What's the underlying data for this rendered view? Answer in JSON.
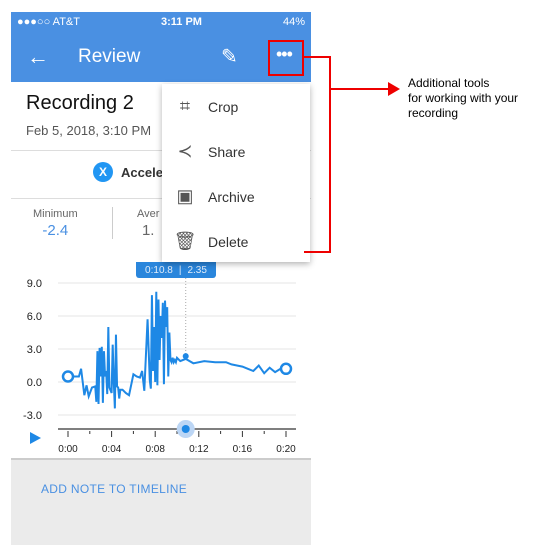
{
  "status": {
    "carrier": "●●●○○ AT&T",
    "time": "3:11 PM",
    "battery": "44%"
  },
  "appbar": {
    "title": "Review",
    "back_icon": "arrow-left-icon",
    "edit_icon": "pencil-icon",
    "more_icon": "more-icon"
  },
  "recording": {
    "title": "Recording 2",
    "date": "Feb 5, 2018, 3:10 PM",
    "sensor": "Acceleration X",
    "sensor_visible": "Accele",
    "sensor_icon": "X"
  },
  "stats": {
    "min_label": "Minimum",
    "min_value": "-2.4",
    "avg_label": "Aver",
    "avg_value": "1."
  },
  "tooltip": {
    "time": "0:10.8",
    "value": "2.35"
  },
  "menu": {
    "items": [
      {
        "label": "Crop",
        "icon": "crop-icon"
      },
      {
        "label": "Share",
        "icon": "share-icon"
      },
      {
        "label": "Archive",
        "icon": "archive-icon"
      },
      {
        "label": "Delete",
        "icon": "delete-icon"
      }
    ]
  },
  "bottom": {
    "add_note": "ADD NOTE TO TIMELINE"
  },
  "annotation": {
    "line1": "Additional tools",
    "line2": "for working with your",
    "line3": "recording"
  },
  "colors": {
    "accent": "#4a90e2",
    "line": "#1e88e5",
    "annotation": "#e00000"
  },
  "chart_data": {
    "type": "line",
    "yticks": [
      "9.0",
      "6.0",
      "3.0",
      "0.0",
      "-3.0"
    ],
    "xticks": [
      "0:00",
      "0:04",
      "0:08",
      "0:12",
      "0:16",
      "0:20"
    ],
    "ylim": [
      -3,
      9
    ],
    "xlim": [
      0,
      20
    ],
    "series": [
      {
        "x": [
          0,
          1,
          1.2,
          1.5,
          1.7,
          1.9,
          2.2,
          2.5,
          2.6,
          2.7,
          2.8,
          2.9,
          3.0,
          3.1,
          3.2,
          3.3,
          3.4,
          3.5,
          3.6,
          3.7,
          3.8,
          4.0,
          4.1,
          4.2,
          4.3,
          4.4,
          4.5,
          4.6,
          4.7,
          4.8,
          5.0,
          5.3,
          5.6,
          6.0,
          6.3,
          6.6,
          6.8,
          7.0,
          7.3,
          7.5,
          7.6,
          7.7,
          7.8,
          7.9,
          8.0,
          8.1,
          8.2,
          8.3,
          8.4,
          8.5,
          8.6,
          8.7,
          8.8,
          8.9,
          9.0,
          9.1,
          9.2,
          9.3,
          9.4,
          9.5,
          9.6,
          9.7,
          9.8,
          9.9,
          10.0,
          10.3,
          10.8,
          11.5,
          12.5,
          13.5,
          14.5,
          15,
          15.5,
          16,
          16.5,
          17,
          17.5,
          18,
          18.5,
          19,
          19.5,
          20
        ],
        "y": [
          0.5,
          0.5,
          1.2,
          -1.2,
          -0.3,
          -1.3,
          -0.5,
          -0.4,
          -1.8,
          2.8,
          -2,
          3.1,
          0.5,
          3.2,
          -1.9,
          2.8,
          0.5,
          1,
          -1.1,
          5,
          -0.5,
          -1,
          3.4,
          0,
          -2.4,
          4.3,
          -0.4,
          -0.5,
          -1.5,
          -0.7,
          -0.7,
          -1.0,
          -1.2,
          0.7,
          0.5,
          0.4,
          1.0,
          -0.8,
          5.7,
          0.2,
          -0.6,
          7.9,
          1,
          5,
          0,
          8.2,
          -0.3,
          7.5,
          2,
          6,
          4,
          7.2,
          -0.2,
          7.4,
          5,
          6.8,
          0.5,
          4.5,
          2,
          1.8,
          2.2,
          1.8,
          2.0,
          1.8,
          2.2,
          1.9,
          2.1,
          1.7,
          1.9,
          1.8,
          1.8,
          1.6,
          1.5,
          1.4,
          1.2,
          1.0,
          1.5,
          0.8,
          1.3,
          0.9,
          1.2,
          1.2
        ]
      }
    ]
  }
}
